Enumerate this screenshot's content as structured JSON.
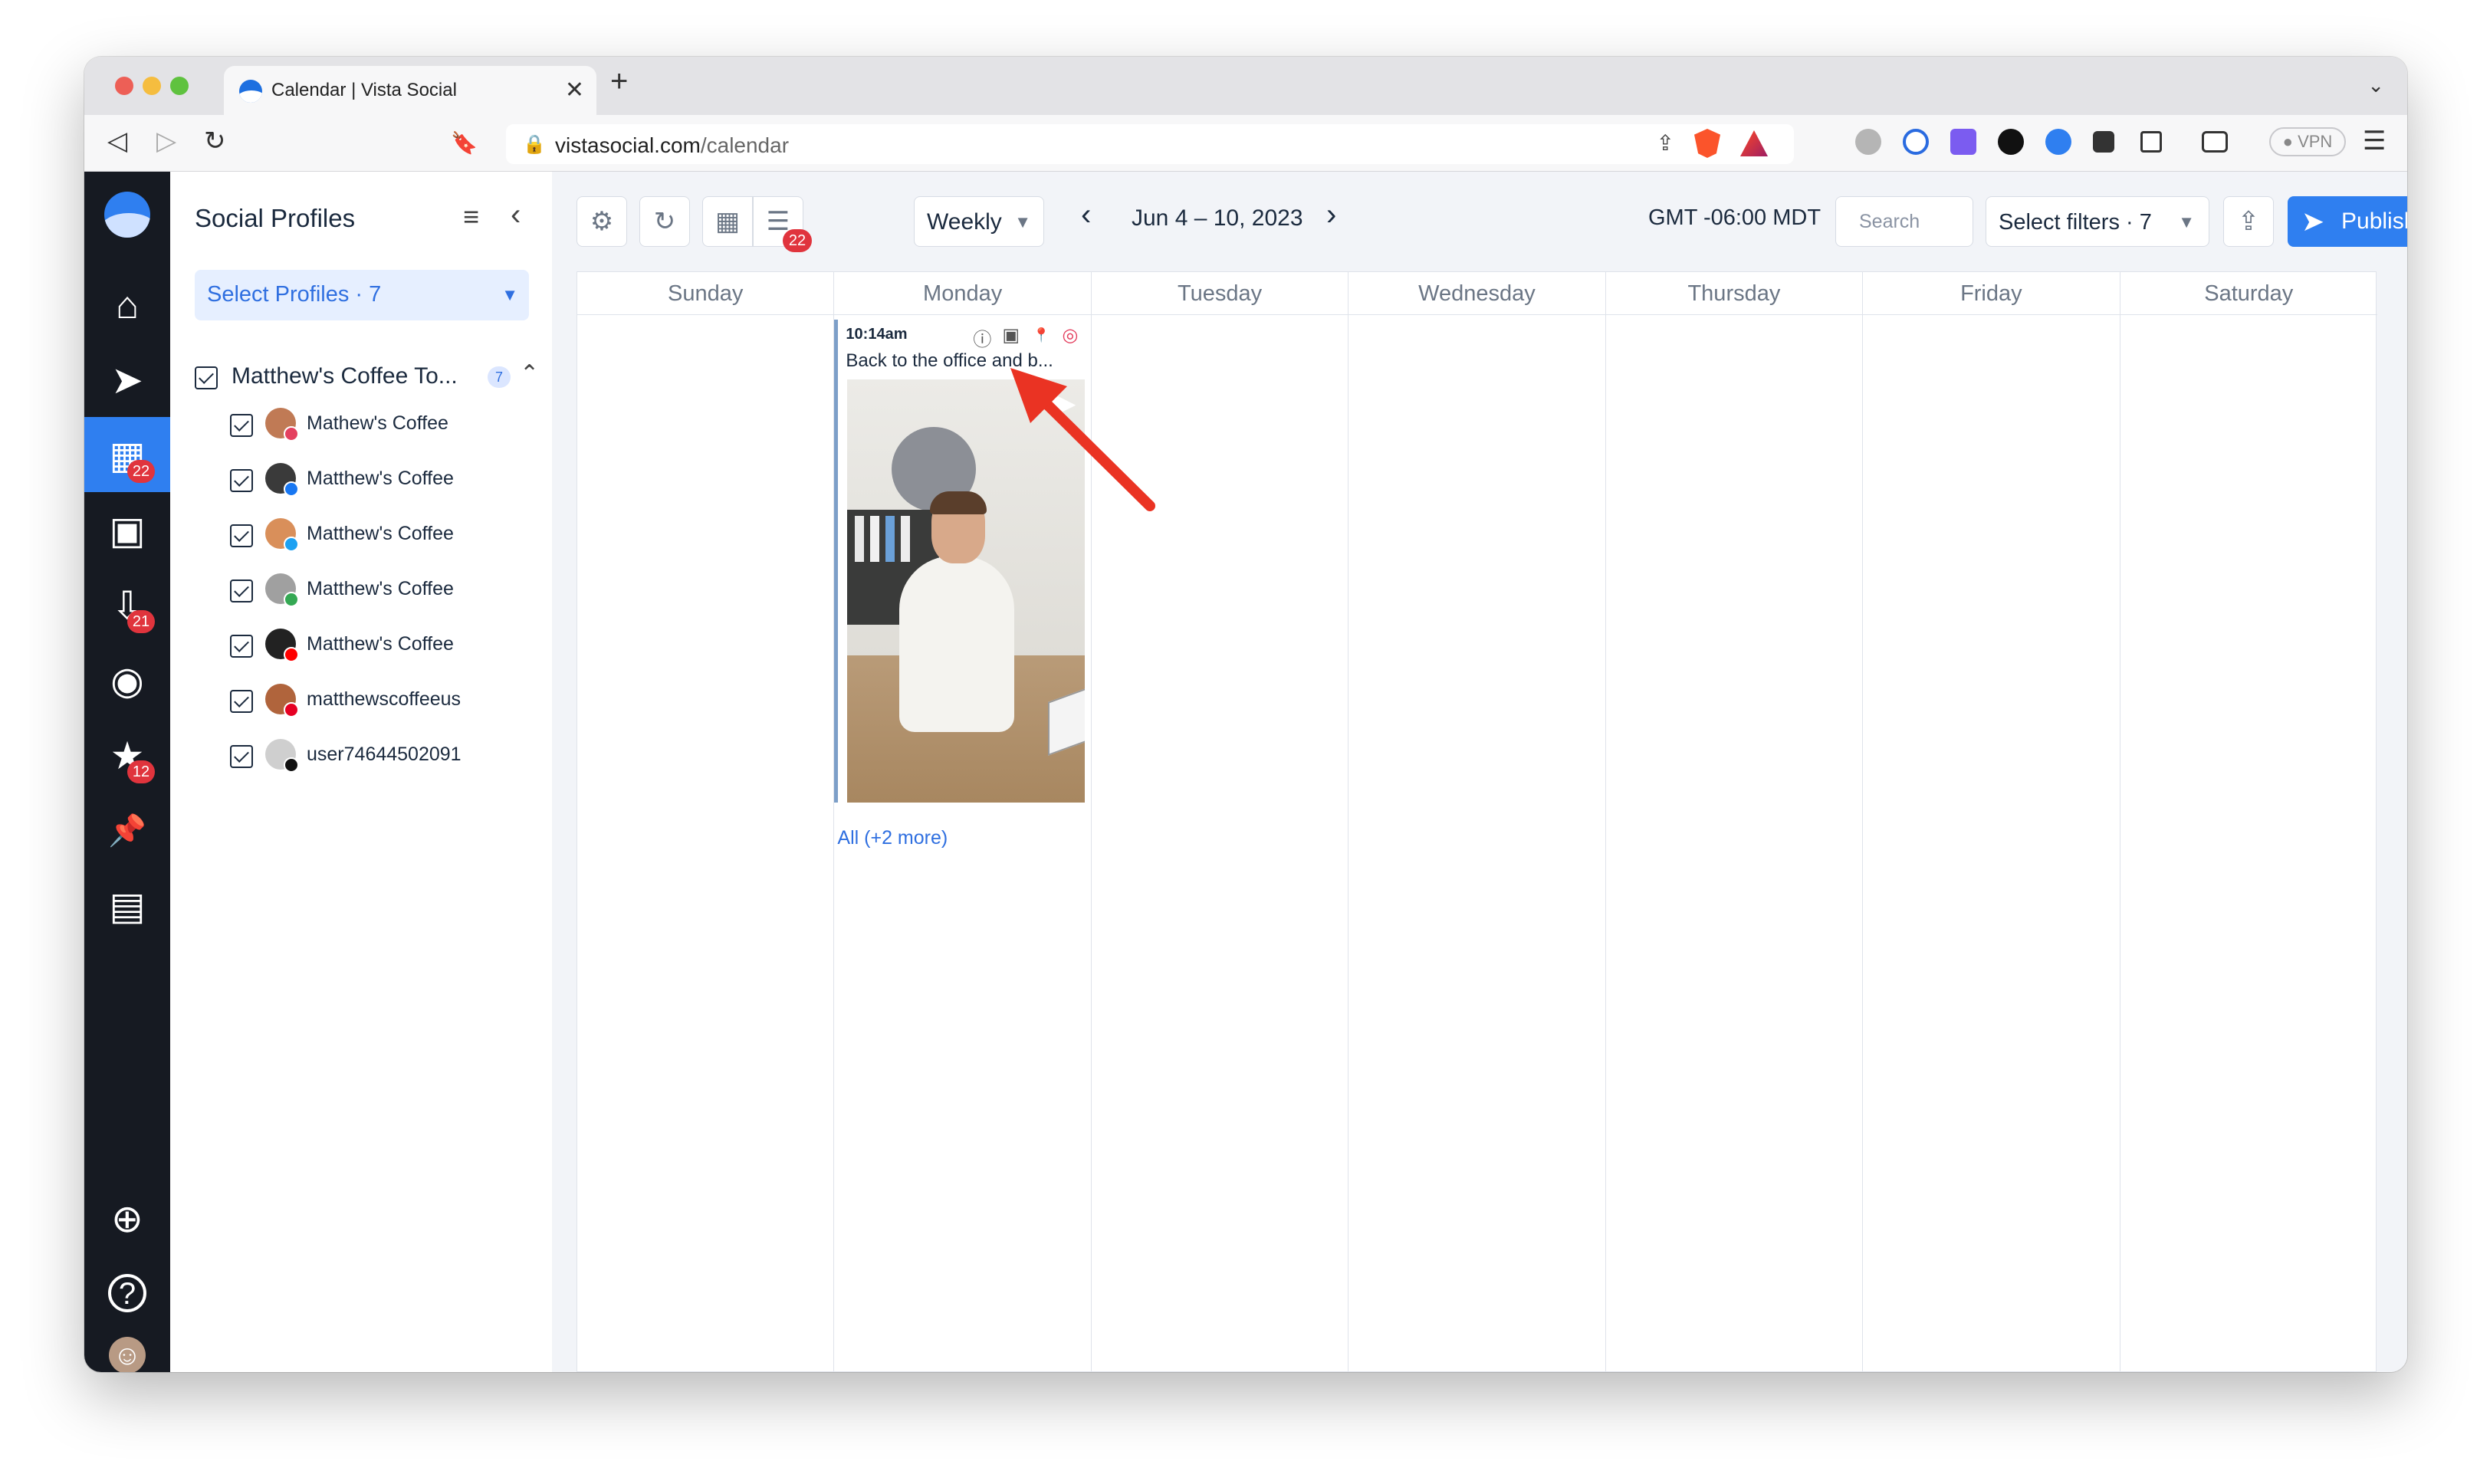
{
  "browser": {
    "tab_title": "Calendar | Vista Social",
    "tab_close": "✕",
    "new_tab": "+",
    "tab_list": "⌄",
    "url_host": "vistasocial.com",
    "url_path": "/calendar",
    "vpn": "● VPN",
    "icons": {
      "back": "back-icon",
      "forward": "forward-icon",
      "reload": "reload-icon",
      "bookmark": "bookmark-icon",
      "lock": "lock-icon",
      "share": "share-icon",
      "menu": "menu-icon"
    },
    "glyphs": {
      "back": "◁",
      "forward": "▷",
      "reload": "↻",
      "bookmark": "🔖",
      "lock": "🔒",
      "share": "⇪",
      "menu": "☰"
    }
  },
  "rail": {
    "badges": {
      "calendar": "22",
      "inbox": "21",
      "reviews": "12"
    },
    "glyphs": {
      "home": "⌂",
      "publish": "➤",
      "calendar": "▦",
      "media": "▣",
      "inbox": "⇩",
      "listening": "◉",
      "reviews": "★",
      "pin": "📌",
      "reports": "▤",
      "add": "⊕",
      "help": "?",
      "avatar": "☺"
    },
    "accent": "#2f7ff0"
  },
  "profiles_panel": {
    "title": "Social Profiles",
    "select_label": "Select Profiles · 7",
    "caret": "▼",
    "filter_glyph": "≡",
    "collapse_glyph": "‹",
    "expand_glyph": "⌃",
    "group": {
      "label": "Matthew's Coffee To...",
      "count": "7"
    },
    "profiles": [
      {
        "name": "Mathew's Coffee",
        "network": "instagram",
        "net_color": "#e4405f",
        "avatar_color": "#c07a55"
      },
      {
        "name": "Matthew's Coffee",
        "network": "facebook",
        "net_color": "#1877f2",
        "avatar_color": "#3a3a3a"
      },
      {
        "name": "Matthew's Coffee",
        "network": "twitter",
        "net_color": "#1da1f2",
        "avatar_color": "#d98f5a"
      },
      {
        "name": "Matthew's Coffee",
        "network": "google",
        "net_color": "#34a853",
        "avatar_color": "#a0a0a0"
      },
      {
        "name": "Matthew's Coffee",
        "network": "youtube",
        "net_color": "#ff0000",
        "avatar_color": "#222222"
      },
      {
        "name": "matthewscoffeeus",
        "network": "pinterest",
        "net_color": "#e60023",
        "avatar_color": "#b0643c"
      },
      {
        "name": "user74644502091",
        "network": "tiktok",
        "net_color": "#111111",
        "avatar_color": "#cfcfcf"
      }
    ]
  },
  "calendar": {
    "list_badge": "22",
    "view": "Weekly",
    "view_caret": "▼",
    "prev": "‹",
    "next": "›",
    "date_range": "Jun 4 – 10, 2023",
    "timezone": "GMT -06:00 MDT",
    "search_placeholder": "Search",
    "filters_label": "Select filters · 7",
    "filters_caret": "▼",
    "publish_label": "Publish",
    "publish_caret": "▼",
    "publish_glyph": "➤",
    "share_glyph": "⇪",
    "settings_glyph": "⚙",
    "refresh_glyph": "↻",
    "month_glyph": "▦",
    "list_glyph": "☰",
    "days": [
      "Sunday",
      "Monday",
      "Tuesday",
      "Wednesday",
      "Thursday",
      "Friday",
      "Saturday"
    ],
    "post": {
      "time": "10:14am",
      "text": "Back to the office and b...",
      "more": "All (+2 more)",
      "icons": [
        "info-icon",
        "reel-icon",
        "pin-icon",
        "instagram-icon"
      ],
      "glyphs": {
        "info": "ⓘ",
        "reel": "▣",
        "pin": "📍",
        "instagram": "◎",
        "play": "▶"
      }
    }
  }
}
